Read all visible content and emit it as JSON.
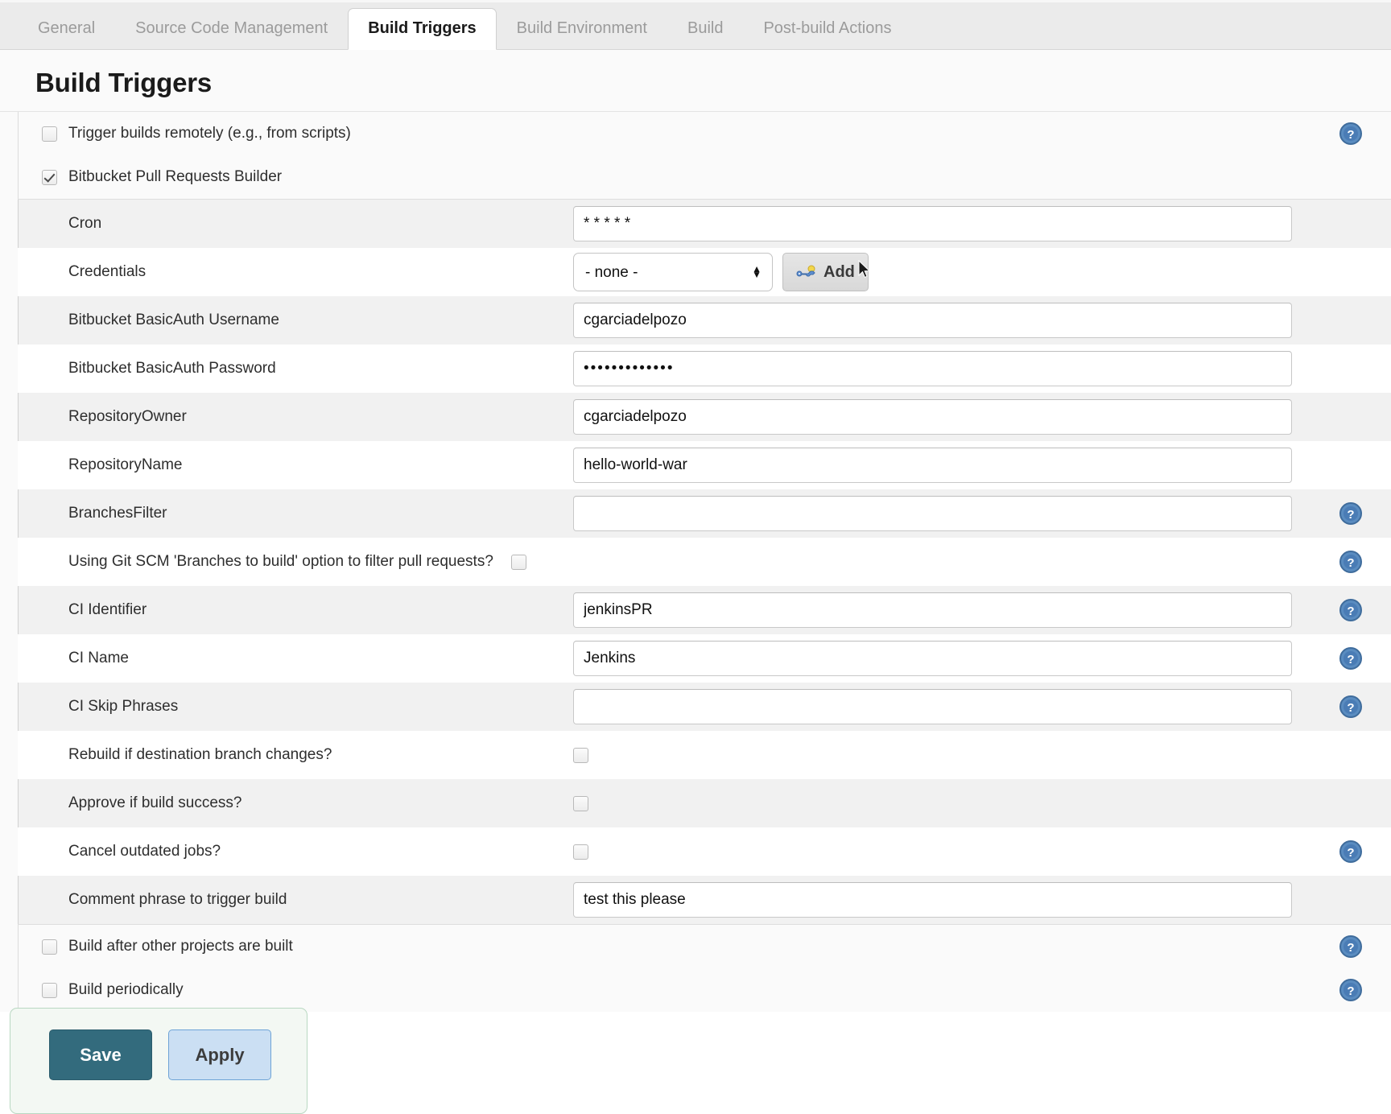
{
  "tabs": [
    {
      "label": "General",
      "active": false
    },
    {
      "label": "Source Code Management",
      "active": false
    },
    {
      "label": "Build Triggers",
      "active": true
    },
    {
      "label": "Build Environment",
      "active": false
    },
    {
      "label": "Build",
      "active": false
    },
    {
      "label": "Post-build Actions",
      "active": false
    }
  ],
  "page": {
    "title": "Build Triggers"
  },
  "top_triggers": [
    {
      "label": "Trigger builds remotely (e.g., from scripts)",
      "checked": false,
      "help": true
    },
    {
      "label": "Bitbucket Pull Requests Builder",
      "checked": true,
      "help": false
    }
  ],
  "fields": {
    "cron": {
      "label": "Cron",
      "value": "* * * * *"
    },
    "credentials": {
      "label": "Credentials",
      "selected": "- none -",
      "options": [
        "- none -"
      ],
      "add_label": "Add"
    },
    "basicauth_user": {
      "label": "Bitbucket BasicAuth Username",
      "value": "cgarciadelpozo"
    },
    "basicauth_pass": {
      "label": "Bitbucket BasicAuth Password",
      "value": "•••••••••••••"
    },
    "repo_owner": {
      "label": "RepositoryOwner",
      "value": "cgarciadelpozo"
    },
    "repo_name": {
      "label": "RepositoryName",
      "value": "hello-world-war"
    },
    "branches_filter": {
      "label": "BranchesFilter",
      "value": ""
    },
    "git_scm_filter": {
      "label": "Using Git SCM 'Branches to build' option to filter pull requests?",
      "checked": false
    },
    "ci_identifier": {
      "label": "CI Identifier",
      "value": "jenkinsPR"
    },
    "ci_name": {
      "label": "CI Name",
      "value": "Jenkins"
    },
    "ci_skip_phrases": {
      "label": "CI Skip Phrases",
      "value": ""
    },
    "rebuild_dest": {
      "label": "Rebuild if destination branch changes?",
      "checked": false
    },
    "approve_success": {
      "label": "Approve if build success?",
      "checked": false
    },
    "cancel_outdated": {
      "label": "Cancel outdated jobs?",
      "checked": false
    },
    "comment_phrase": {
      "label": "Comment phrase to trigger build",
      "value": "test this please"
    }
  },
  "obscured_rows": [
    {
      "label": "Build after other projects are built"
    },
    {
      "label": "Build periodically"
    }
  ],
  "savebar": {
    "save_label": "Save",
    "apply_label": "Apply"
  },
  "colors": {
    "active_tab_text": "#1a1a1a",
    "inactive_tab_text": "#9b9b9b",
    "panel_bg": "#f1f1f1",
    "save_bg": "#336b7d",
    "apply_bg": "#cbdff3",
    "help_icon": "#4a7cb5",
    "savebar_border": "#b9d8c2"
  },
  "icons": {
    "help": "help-question-icon",
    "key": "key-icon",
    "cursor": "cursor-pointer-icon"
  }
}
